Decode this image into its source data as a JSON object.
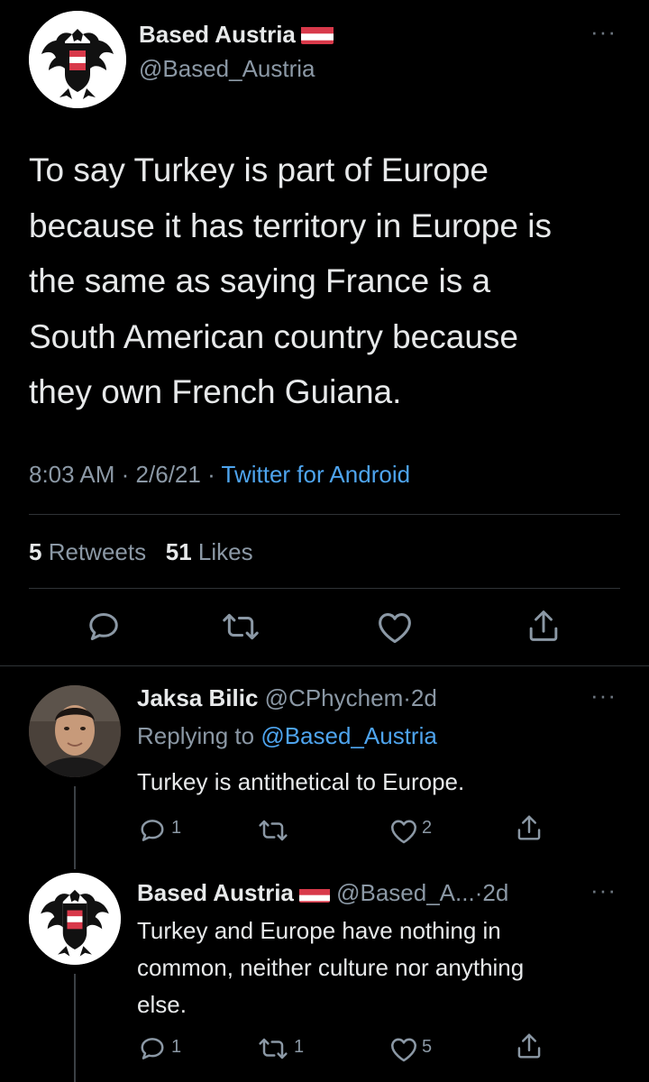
{
  "main_tweet": {
    "display_name": "Based Austria",
    "handle": "@Based_Austria",
    "text_lines": [
      "To say Turkey is part of Europe",
      "because it has territory in Europe is",
      "the same as saying France is a",
      "South American country because",
      "they own French Guiana."
    ],
    "time": "8:03 AM",
    "separator": "·",
    "date": "2/6/21",
    "source": "Twitter for Android",
    "retweets_count": "5",
    "retweets_label": "Retweets",
    "likes_count": "51",
    "likes_label": "Likes",
    "more": "···"
  },
  "replies": [
    {
      "display_name": "Jaksa Bilic",
      "handle": "@CPhychem",
      "separator": "·",
      "time": "2d",
      "replying_label": "Replying to",
      "replying_handle": "@Based_Austria",
      "text_lines": [
        "Turkey is antithetical to Europe."
      ],
      "reply_count": "1",
      "retweet_count": "",
      "like_count": "2",
      "more": "···"
    },
    {
      "display_name": "Based Austria",
      "handle": "@Based_A...",
      "separator": "·",
      "time": "2d",
      "text_lines": [
        "Turkey and Europe have nothing in",
        "common, neither culture nor anything",
        "else."
      ],
      "reply_count": "1",
      "retweet_count": "1",
      "like_count": "5",
      "more": "···"
    }
  ],
  "colors": {
    "background": "#000000",
    "text": "#e7e9ea",
    "secondary": "#8b98a5",
    "link": "#4ea4ee",
    "flag_red": "#d8394a",
    "divider": "#2f3336"
  },
  "icons": [
    "reply-icon",
    "retweet-icon",
    "like-icon",
    "share-icon",
    "more-icon",
    "austria-flag-icon",
    "eagle-logo"
  ]
}
